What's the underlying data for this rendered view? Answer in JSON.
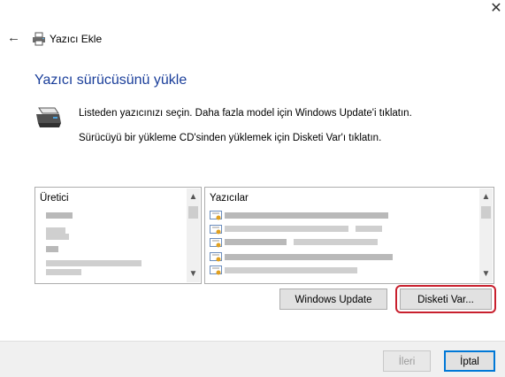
{
  "window": {
    "close_glyph": "✕",
    "back_glyph": "←",
    "title": "Yazıcı Ekle"
  },
  "page": {
    "heading": "Yazıcı sürücüsünü yükle",
    "instruction_1": "Listeden yazıcınızı seçin. Daha fazla model için Windows Update'i tıklatın.",
    "instruction_2": "Sürücüyü bir yükleme CD'sinden yüklemek için Disketi Var'ı tıklatın."
  },
  "manufacturer_list": {
    "header": "Üretici",
    "icon": "printer-icon"
  },
  "printer_list": {
    "header": "Yazıcılar",
    "item_icon": "certificate-icon"
  },
  "buttons": {
    "windows_update": "Windows Update",
    "have_disk": "Disketi Var...",
    "next": "İleri",
    "cancel": "İptal"
  },
  "colors": {
    "heading": "#1a3e9a",
    "highlight_ring": "#c8202e",
    "focus_border": "#0078d7"
  }
}
